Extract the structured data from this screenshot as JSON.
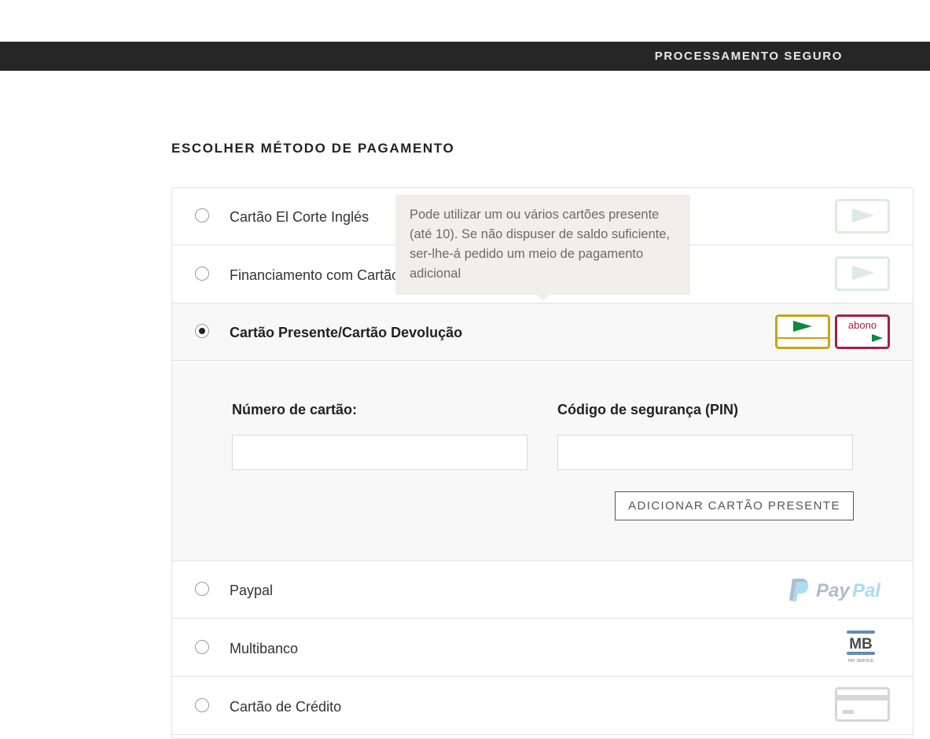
{
  "header": {
    "secure_label": "PROCESSAMENTO SEGURO"
  },
  "page": {
    "title": "ESCOLHER MÉTODO DE PAGAMENTO"
  },
  "payment_methods": [
    {
      "label": "Cartão El Corte Inglés",
      "selected": false,
      "logo": "eci-card-icon"
    },
    {
      "label": "Financiamento com Cartão",
      "selected": false,
      "logo": "eci-card-icon"
    },
    {
      "label": "Cartão Presente/Cartão Devolução",
      "selected": true,
      "logo": "gift-card-icon"
    },
    {
      "label": "Paypal",
      "selected": false,
      "logo": "paypal-logo"
    },
    {
      "label": "Multibanco",
      "selected": false,
      "logo": "multibanco-logo"
    },
    {
      "label": "Cartão de Crédito",
      "selected": false,
      "logo": "credit-card-icon"
    }
  ],
  "gift_card_form": {
    "card_number_label": "Número de cartão:",
    "card_number_value": "",
    "pin_label": "Código de segurança (PIN)",
    "pin_value": "",
    "add_button_label": "ADICIONAR CARTÃO PRESENTE"
  },
  "tooltip": {
    "text": "Pode utilizar um ou vários cartões presente (até 10). Se não dispuser de saldo suficiente, ser-lhe-á pedido um meio de pagamento adicional"
  },
  "logos": {
    "abono_text": "abono",
    "paypal_text_1": "Pay",
    "paypal_text_2": "Pal",
    "mb_text": "MB",
    "mb_sub": "PAY SERVICE"
  },
  "colors": {
    "topbar": "#262626",
    "eci_green": "#0b8a3c",
    "gift_gold": "#c9a416",
    "abono_red": "#a31f45",
    "paypal_dark": "#253b80",
    "paypal_light": "#179bd7"
  }
}
